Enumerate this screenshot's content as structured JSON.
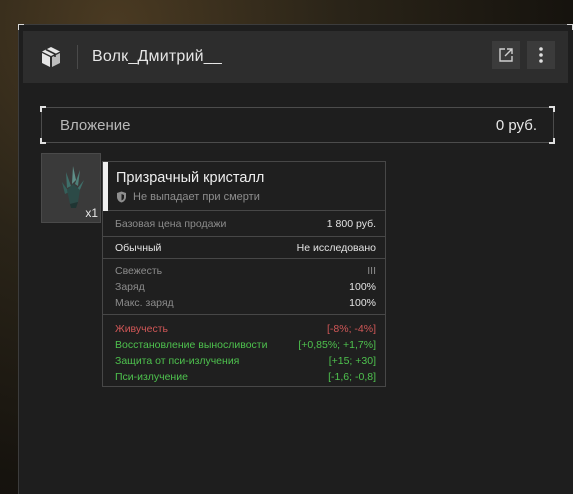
{
  "window": {
    "title": "Волк_Дмитрий__",
    "header_icon": "box-icon",
    "buttons": [
      "external-link-icon",
      "more-vertical-icon"
    ]
  },
  "investment": {
    "label": "Вложение",
    "value": "0 руб."
  },
  "item_slot": {
    "quantity": "x1",
    "icon": "crystal-icon"
  },
  "tooltip": {
    "name": "Призрачный кристалл",
    "subtitle": "Не выпадает при смерти",
    "base_price": {
      "label": "Базовая цена продажи",
      "value": "1 800 руб."
    },
    "rarity": {
      "label": "Обычный",
      "value": "Не исследовано"
    },
    "stats": [
      {
        "label": "Свежесть",
        "value": "III"
      },
      {
        "label": "Заряд",
        "value": "100%"
      },
      {
        "label": "Макс. заряд",
        "value": "100%"
      }
    ],
    "effects": [
      {
        "label": "Живучесть",
        "value": "[-8%; -4%]",
        "color": "#d05757"
      },
      {
        "label": "Восстановление выносливости",
        "value": "[+0,85%; +1,7%]",
        "color": "#4ec24e"
      },
      {
        "label": "Защита от пси-излучения",
        "value": "[+15; +30]",
        "color": "#4ec24e"
      },
      {
        "label": "Пси-излучение",
        "value": "[-1,6; -0,8]",
        "color": "#4ec24e"
      }
    ]
  }
}
